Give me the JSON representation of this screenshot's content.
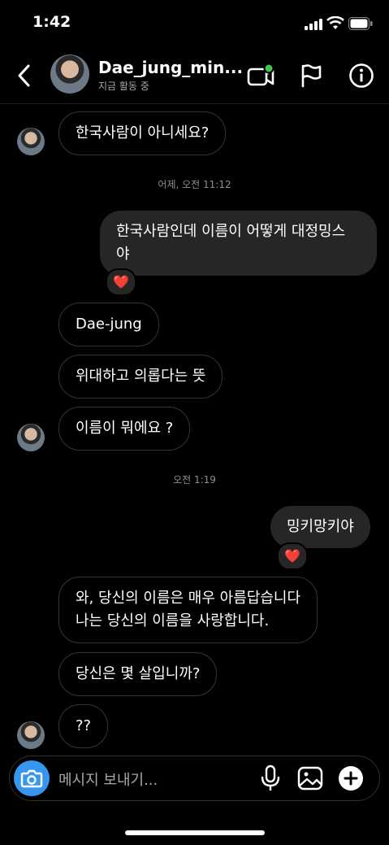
{
  "status_bar": {
    "time": "1:42"
  },
  "header": {
    "username": "Dae_jung_min...",
    "activity": "지금 활동 중",
    "icons": [
      "back-icon",
      "video-call-icon",
      "flag-icon",
      "info-icon"
    ],
    "video_status_color": "#3ec44d"
  },
  "messages": [
    {
      "type": "received",
      "text": "한국사람이 아니세요?",
      "avatar": true
    },
    {
      "type": "timestamp",
      "text": "어제, 오전 11:12"
    },
    {
      "type": "sent",
      "text_line1": "한국사람인데 이름이 어떻게 대정밍스",
      "text_line2": "야",
      "reaction": "❤️"
    },
    {
      "type": "received",
      "text": "Dae-jung"
    },
    {
      "type": "received",
      "text": "위대하고 의롭다는 뜻"
    },
    {
      "type": "received",
      "text": "이름이 뭐에요 ?",
      "avatar": true
    },
    {
      "type": "timestamp",
      "text": "오전 1:19"
    },
    {
      "type": "sent",
      "text": "밍키망키야",
      "reaction": "❤️"
    },
    {
      "type": "received",
      "text_line1": "와, 당신의 이름은 매우 아름답습니다",
      "text_line2": "나는 당신의 이름을 사랑합니다."
    },
    {
      "type": "received",
      "text": "당신은 몇 살입니까?"
    },
    {
      "type": "received",
      "text": "??",
      "avatar": true
    }
  ],
  "composer": {
    "placeholder": "메시지 보내기...",
    "accent": "#3797f0"
  }
}
